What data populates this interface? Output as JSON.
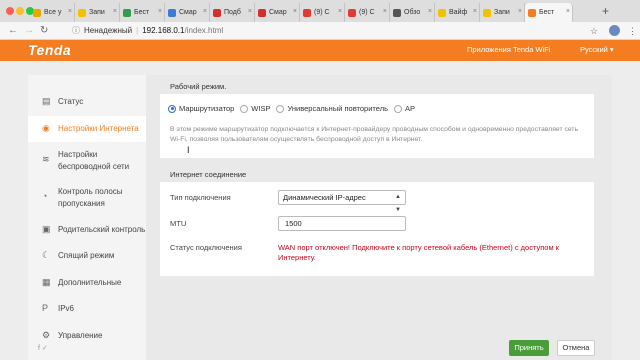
{
  "browser": {
    "tabs": [
      {
        "label": "Все у",
        "fav_color": "#e8a800"
      },
      {
        "label": "Запи",
        "fav_color": "#f2c200"
      },
      {
        "label": "Бест",
        "fav_color": "#2e9e4a"
      },
      {
        "label": "Смар",
        "fav_color": "#3a7bd5"
      },
      {
        "label": "Подб",
        "fav_color": "#d32f2f"
      },
      {
        "label": "Смар",
        "fav_color": "#d32f2f"
      },
      {
        "label": "(9) С",
        "fav_color": "#e53935"
      },
      {
        "label": "(9) С",
        "fav_color": "#e53935"
      },
      {
        "label": "Обзо",
        "fav_color": "#555555"
      },
      {
        "label": "Вайф",
        "fav_color": "#f2c200"
      },
      {
        "label": "Запи",
        "fav_color": "#f2c200"
      },
      {
        "label": "Бест",
        "fav_color": "#f47d22",
        "active": true
      }
    ],
    "new_tab": "+",
    "security_label": "Ненадежный",
    "url_host": "192.168.0.1",
    "url_path": "/index.html"
  },
  "header": {
    "logo": "Tenda",
    "app_link": "Приложения Tenda WiFi",
    "language": "Русский ▾"
  },
  "sidebar": {
    "items": [
      {
        "label": "Статус",
        "icon": "status-icon"
      },
      {
        "label": "Настройки Интернета",
        "icon": "globe-icon",
        "active": true
      },
      {
        "label": "Настройки",
        "label2": "беспроводной сети",
        "icon": "wifi-icon"
      },
      {
        "label": "Контроль полосы",
        "label2": "пропускания",
        "icon": "bandwidth-icon"
      },
      {
        "label": "Родительский контроль",
        "icon": "parental-icon"
      },
      {
        "label": "Спящий режим",
        "icon": "sleep-icon"
      },
      {
        "label": "Дополнительные",
        "icon": "advanced-icon"
      },
      {
        "label": "IPv6",
        "icon": "ipv6-icon"
      },
      {
        "label": "Управление",
        "icon": "management-icon"
      }
    ],
    "social": "f  ✓"
  },
  "work_mode": {
    "title": "Рабочий режим.",
    "options": [
      "Маршрутизатор",
      "WISP",
      "Универсальный повторитель",
      "AP"
    ],
    "selected": "Маршрутизатор",
    "description": "В этом режиме маршрутизатор подключается к Интернет-провайдеру проводным способом и одновременно предоставляет сеть Wi-Fi, позволяя пользователям осуществлять беспроводной доступ в Интернет."
  },
  "internet": {
    "title": "Интернет соединение",
    "conn_type_label": "Тип подключения",
    "conn_type_value": "Динамический IP-адрес",
    "mtu_label": "MTU",
    "mtu_value": "1500",
    "status_label": "Статус подключения",
    "status_value": "WAN порт отключен! Подключите к порту сетевой кабель (Ethernet) с доступом к Интернету."
  },
  "actions": {
    "ok": "Принять",
    "cancel": "Отмена"
  }
}
